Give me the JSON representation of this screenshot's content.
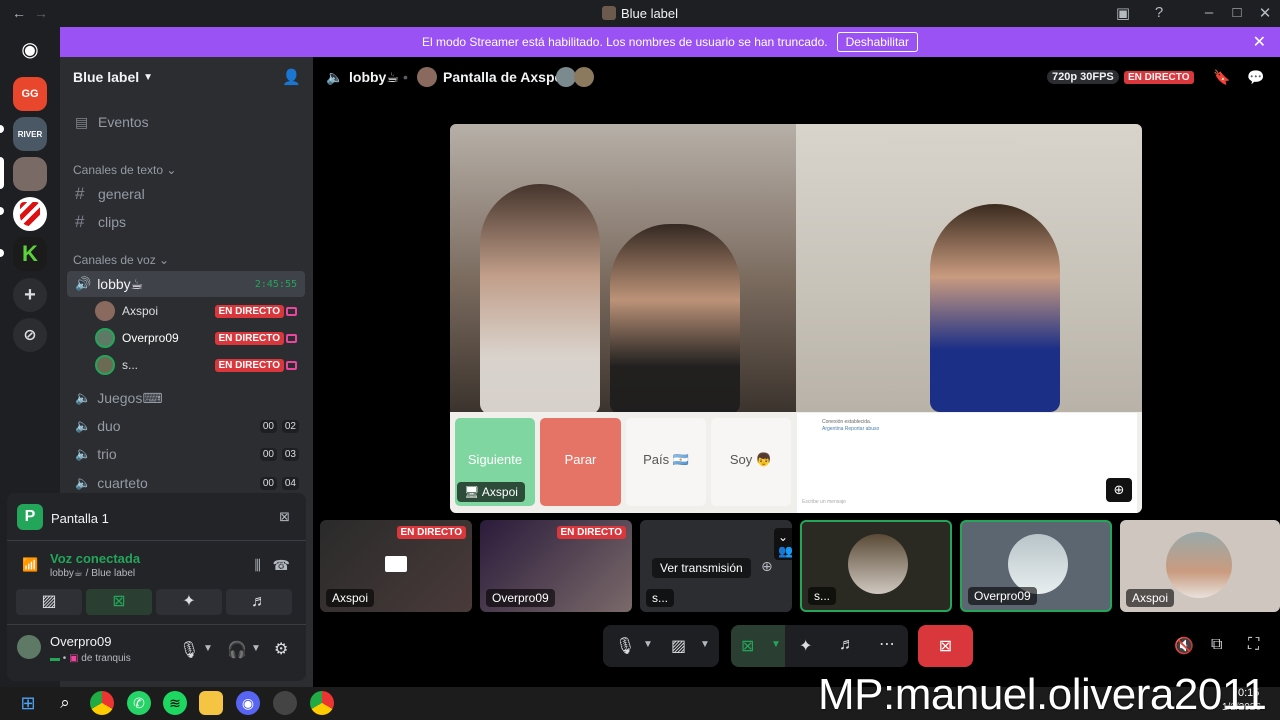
{
  "window": {
    "title": "Blue label"
  },
  "banner": {
    "text": "El modo Streamer está habilitado. Los nombres de usuario se han truncado.",
    "button": "Deshabilitar"
  },
  "server": {
    "name": "Blue label"
  },
  "sidebar": {
    "events": "Eventos",
    "text_category": "Canales de texto",
    "text_channels": [
      "general",
      "clips"
    ],
    "voice_category": "Canales de voz",
    "lobby": {
      "name": "lobby☕",
      "timer": "2:45:55"
    },
    "voice_users": [
      {
        "name": "Axspoi",
        "badge": "EN DIRECTO"
      },
      {
        "name": "Overpro09",
        "badge": "EN DIRECTO"
      },
      {
        "name": "s...",
        "badge": "EN DIRECTO"
      }
    ],
    "other_voice": [
      {
        "name": "Juegos⌨",
        "c1": "",
        "c2": ""
      },
      {
        "name": "duo",
        "c1": "00",
        "c2": "02"
      },
      {
        "name": "trio",
        "c1": "00",
        "c2": "03"
      },
      {
        "name": "cuarteto",
        "c1": "00",
        "c2": "04"
      }
    ]
  },
  "panel": {
    "screen_label": "Pantalla 1",
    "voice_status": "Voz conectada",
    "voice_location": "lobby☕ / Blue label",
    "user_name": "Overpro09",
    "user_status": "de tranquis"
  },
  "main": {
    "channel": "lobby☕",
    "screen_title": "Pantalla de Axspoi",
    "quality": "720p 30FPS",
    "live": "EN DIRECTO"
  },
  "video": {
    "buttons": [
      "Siguiente",
      "Parar",
      "País 🇦🇷",
      "Soy 👦"
    ],
    "chat_line1": "Conexión establecida.",
    "chat_line2": "Argentina Reportar abuso",
    "chat_placeholder": "Escribe un mensaje",
    "streamer_tag": "Axspoi"
  },
  "tiles": [
    {
      "label": "Axspoi",
      "badge": "EN DIRECTO"
    },
    {
      "label": "Overpro09",
      "badge": "EN DIRECTO"
    },
    {
      "label": "s...",
      "action": "Ver transmisión"
    },
    {
      "label": "s..."
    },
    {
      "label": "Overpro09"
    },
    {
      "label": "Axspoi"
    }
  ],
  "taskbar": {
    "time": "0:15",
    "date": "1/2/2026"
  },
  "watermark": "MP:manuel.olivera2011",
  "colors": {
    "accent": "#9b52f5",
    "live": "#da373c",
    "green": "#23a55a"
  }
}
